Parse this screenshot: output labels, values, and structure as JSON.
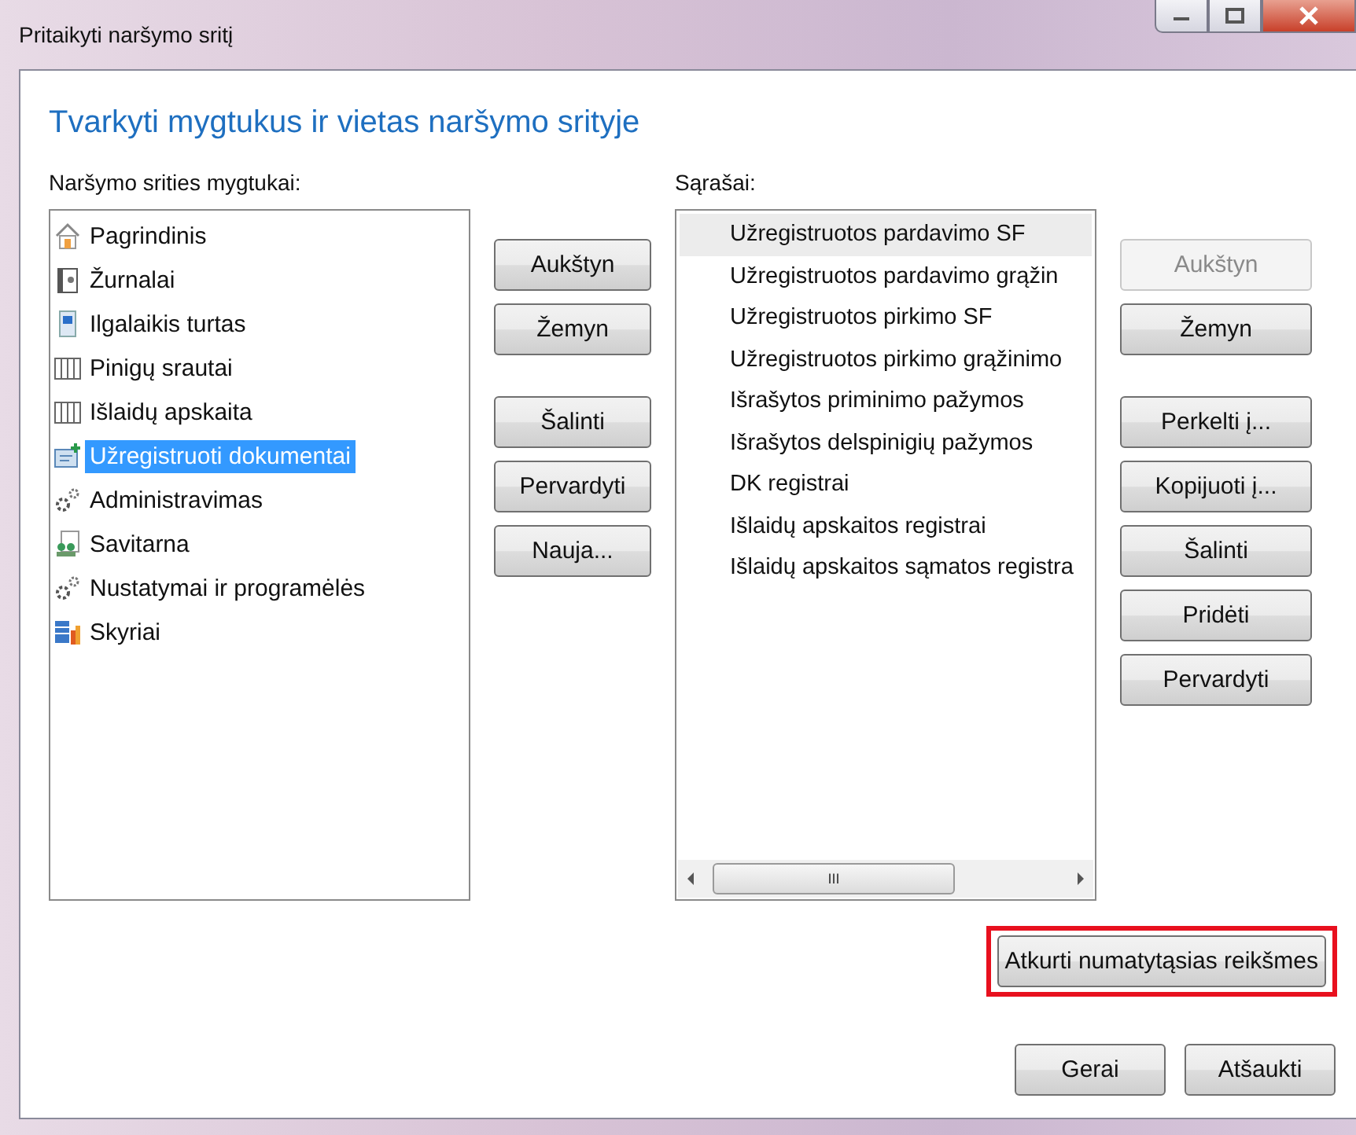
{
  "window": {
    "title": "Pritaikyti naršymo sritį"
  },
  "heading": "Tvarkyti mygtukus ir vietas naršymo srityje",
  "nav_buttons": {
    "label": "Naršymo srities mygtukai:",
    "items": [
      {
        "label": "Pagrindinis",
        "selected": false
      },
      {
        "label": "Žurnalai",
        "selected": false
      },
      {
        "label": "Ilgalaikis turtas",
        "selected": false
      },
      {
        "label": "Pinigų srautai",
        "selected": false
      },
      {
        "label": "Išlaidų apskaita",
        "selected": false
      },
      {
        "label": "Užregistruoti dokumentai",
        "selected": true
      },
      {
        "label": "Administravimas",
        "selected": false
      },
      {
        "label": "Savitarna",
        "selected": false
      },
      {
        "label": "Nustatymai ir programėlės",
        "selected": false
      },
      {
        "label": "Skyriai",
        "selected": false
      }
    ]
  },
  "nav_button_actions": [
    [
      {
        "label": "Aukštyn",
        "disabled": false
      },
      {
        "label": "Žemyn",
        "disabled": false
      }
    ],
    [
      {
        "label": "Šalinti",
        "disabled": false
      },
      {
        "label": "Pervardyti",
        "disabled": false
      },
      {
        "label": "Nauja...",
        "disabled": false
      }
    ]
  ],
  "lists": {
    "label": "Sąrašai:",
    "items": [
      {
        "label": "Užregistruotos pardavimo SF",
        "selected": true
      },
      {
        "label": "Užregistruotos pardavimo grąžin",
        "selected": false
      },
      {
        "label": "Užregistruotos pirkimo SF",
        "selected": false
      },
      {
        "label": "Užregistruotos pirkimo grąžinimo",
        "selected": false
      },
      {
        "label": "Išrašytos priminimo pažymos",
        "selected": false
      },
      {
        "label": "Išrašytos delspinigių pažymos",
        "selected": false
      },
      {
        "label": "DK registrai",
        "selected": false
      },
      {
        "label": "Išlaidų apskaitos registrai",
        "selected": false
      },
      {
        "label": "Išlaidų apskaitos sąmatos registra",
        "selected": false
      }
    ],
    "scrollbar_grip": "III"
  },
  "list_actions": [
    [
      {
        "label": "Aukštyn",
        "disabled": true
      },
      {
        "label": "Žemyn",
        "disabled": false
      }
    ],
    [
      {
        "label": "Perkelti į...",
        "disabled": false
      },
      {
        "label": "Kopijuoti į...",
        "disabled": false
      },
      {
        "label": "Šalinti",
        "disabled": false
      },
      {
        "label": "Pridėti",
        "disabled": false
      },
      {
        "label": "Pervardyti",
        "disabled": false
      }
    ]
  ],
  "reset_button": {
    "label": "Atkurti numatytąsias reikšmes",
    "highlighted": true
  },
  "dialog_buttons": [
    "Gerai",
    "Atšaukti"
  ]
}
